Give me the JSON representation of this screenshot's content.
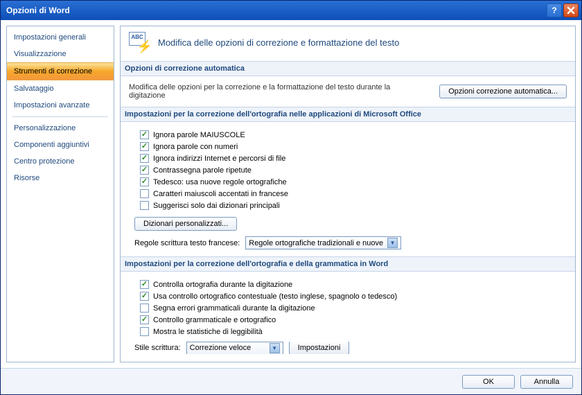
{
  "window": {
    "title": "Opzioni di Word"
  },
  "sidebar": {
    "items": [
      {
        "label": "Impostazioni generali",
        "selected": false
      },
      {
        "label": "Visualizzazione",
        "selected": false
      },
      {
        "label": "Strumenti di correzione",
        "selected": true
      },
      {
        "label": "Salvataggio",
        "selected": false
      },
      {
        "label": "Impostazioni avanzate",
        "selected": false
      }
    ],
    "items2": [
      {
        "label": "Personalizzazione"
      },
      {
        "label": "Componenti aggiuntivi"
      },
      {
        "label": "Centro protezione"
      },
      {
        "label": "Risorse"
      }
    ]
  },
  "header": {
    "icon_text": "ABC",
    "title": "Modifica delle opzioni di correzione e formattazione del testo"
  },
  "section_auto": {
    "heading": "Opzioni di correzione automatica",
    "desc": "Modifica delle opzioni per la correzione e la formattazione del testo durante la digitazione",
    "button": "Opzioni correzione automatica..."
  },
  "section_office": {
    "heading": "Impostazioni per la correzione dell'ortografia nelle applicazioni di Microsoft Office",
    "checks": [
      {
        "label": "Ignora parole MAIUSCOLE",
        "checked": true
      },
      {
        "label": "Ignora parole con numeri",
        "checked": true
      },
      {
        "label": "Ignora indirizzi Internet e percorsi di file",
        "checked": true
      },
      {
        "label": "Contrassegna parole ripetute",
        "checked": true
      },
      {
        "label": "Tedesco: usa nuove regole ortografiche",
        "checked": true
      },
      {
        "label": "Caratteri maiuscoli accentati in francese",
        "checked": false
      },
      {
        "label": "Suggerisci solo dai dizionari principali",
        "checked": false
      }
    ],
    "dict_button": "Dizionari personalizzati...",
    "french_label": "Regole scrittura testo francese:",
    "french_value": "Regole ortografiche tradizionali e nuove"
  },
  "section_word": {
    "heading": "Impostazioni per la correzione dell'ortografia e della grammatica in Word",
    "checks": [
      {
        "label": "Controlla ortografia durante la digitazione",
        "checked": true
      },
      {
        "label": "Usa controllo ortografico contestuale (testo inglese, spagnolo o tedesco)",
        "checked": true
      },
      {
        "label": "Segna errori grammaticali durante la digitazione",
        "checked": false
      },
      {
        "label": "Controllo grammaticale e ortografico",
        "checked": true
      },
      {
        "label": "Mostra le statistiche di leggibilità",
        "checked": false
      }
    ],
    "style_label": "Stile scrittura:",
    "style_value": "Correzione veloce",
    "settings_button": "Impostazioni"
  },
  "footer": {
    "ok": "OK",
    "cancel": "Annulla"
  }
}
